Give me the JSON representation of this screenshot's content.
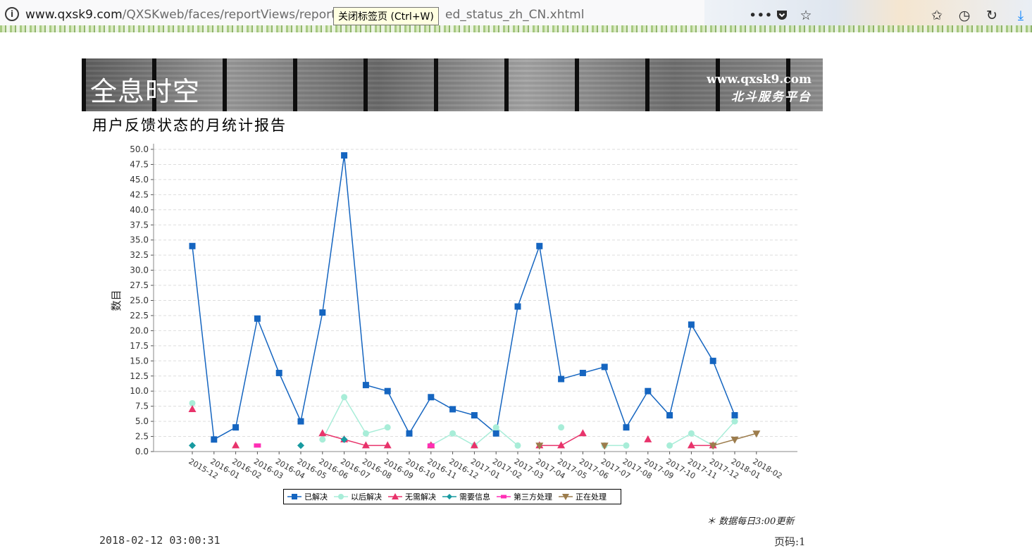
{
  "browser": {
    "url_host": "www.qxsk9.com",
    "url_path": "/QXSKweb/faces/reportViews/report",
    "url_tail": "ed_status_zh_CN.xhtml",
    "tooltip": "关闭标签页 (Ctrl+W)",
    "icons": [
      "info-icon",
      "more-icon",
      "pocket-icon",
      "star-icon",
      "bookmarks-icon",
      "history-icon",
      "sync-icon",
      "download-icon"
    ]
  },
  "banner": {
    "brand": "全息时空",
    "site": "www.qxsk9.com",
    "subtitle": "北斗服务平台"
  },
  "report": {
    "title": "用户反馈状态的月统计报告",
    "note": "＊ 数据每日3:00更新",
    "generated": "2018-02-12 03:00:31",
    "page": "页码:1"
  },
  "chart_data": {
    "type": "line",
    "ylabel": "数目",
    "xlabel": "",
    "ylim": [
      0,
      50
    ],
    "ytick_step": 2.5,
    "grid": "horizontal-dashed",
    "legend_position": "bottom",
    "categories": [
      "2015-12",
      "2016-01",
      "2016-02",
      "2016-03",
      "2016-04",
      "2016-05",
      "2016-06",
      "2016-07",
      "2016-08",
      "2016-09",
      "2016-10",
      "2016-11",
      "2016-12",
      "2017-01",
      "2017-02",
      "2017-03",
      "2017-04",
      "2017-05",
      "2017-06",
      "2017-07",
      "2017-08",
      "2017-09",
      "2017-10",
      "2017-11",
      "2017-12",
      "2018-01",
      "2018-02"
    ],
    "series": [
      {
        "name": "已解决",
        "color": "#1565c0",
        "marker": "square",
        "values": [
          34,
          2,
          4,
          22,
          13,
          5,
          23,
          49,
          11,
          10,
          3,
          9,
          7,
          6,
          3,
          24,
          34,
          12,
          13,
          14,
          4,
          10,
          6,
          21,
          15,
          6,
          null
        ]
      },
      {
        "name": "以后解决",
        "color": "#a8edd8",
        "marker": "circle",
        "values": [
          8,
          null,
          null,
          null,
          null,
          null,
          2,
          9,
          3,
          4,
          null,
          1,
          3,
          1,
          4,
          1,
          null,
          4,
          null,
          1,
          1,
          null,
          1,
          3,
          1,
          5,
          null
        ]
      },
      {
        "name": "无需解决",
        "color": "#e8336b",
        "marker": "triangle",
        "values": [
          7,
          null,
          1,
          null,
          null,
          null,
          3,
          2,
          1,
          1,
          null,
          1,
          null,
          1,
          null,
          null,
          1,
          1,
          3,
          null,
          null,
          2,
          null,
          1,
          1,
          null,
          null
        ]
      },
      {
        "name": "需要信息",
        "color": "#189aa0",
        "marker": "diamond",
        "values": [
          1,
          null,
          null,
          null,
          null,
          1,
          null,
          2,
          null,
          null,
          null,
          null,
          null,
          null,
          null,
          null,
          null,
          null,
          null,
          null,
          null,
          null,
          null,
          null,
          null,
          null,
          null
        ]
      },
      {
        "name": "第三方处理",
        "color": "#ff2fb5",
        "marker": "bar",
        "values": [
          null,
          null,
          null,
          1,
          null,
          null,
          null,
          null,
          null,
          null,
          null,
          1,
          null,
          null,
          null,
          null,
          null,
          null,
          null,
          null,
          null,
          null,
          null,
          null,
          null,
          null,
          null
        ]
      },
      {
        "name": "正在处理",
        "color": "#9c7c4c",
        "marker": "triangle-down",
        "values": [
          null,
          null,
          null,
          null,
          null,
          null,
          null,
          null,
          null,
          null,
          null,
          null,
          null,
          null,
          null,
          null,
          1,
          null,
          null,
          1,
          null,
          null,
          null,
          null,
          1,
          2,
          3
        ]
      }
    ]
  }
}
